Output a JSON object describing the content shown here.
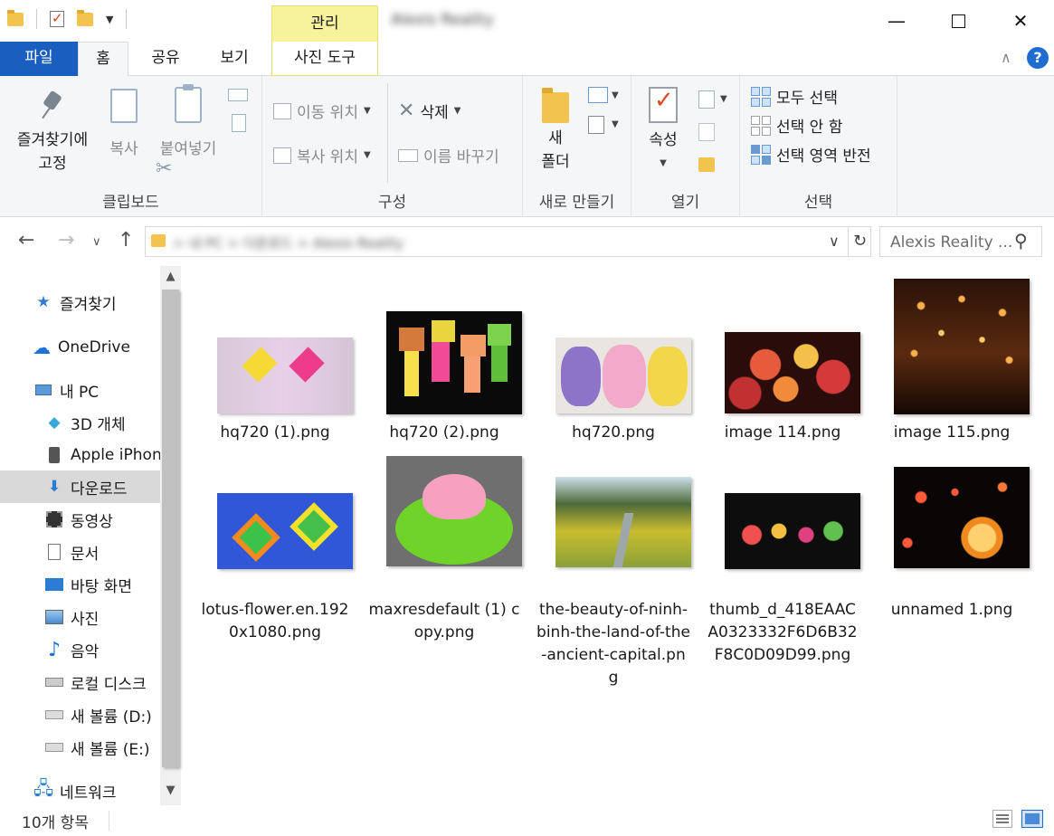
{
  "titlebar": {
    "context_group": "관리",
    "window_title": "Alexis Reality",
    "controls": {
      "minimize": "—",
      "close": "✕"
    }
  },
  "tabs": {
    "file": "파일",
    "home": "홈",
    "share": "공유",
    "view": "보기",
    "photo_tools": "사진 도구"
  },
  "ribbon": {
    "clipboard": {
      "label": "클립보드",
      "pin_line1": "즐겨찾기에",
      "pin_line2": "고정",
      "copy": "복사",
      "paste": "붙여넣기"
    },
    "organize": {
      "label": "구성",
      "move_to": "이동 위치",
      "copy_to": "복사 위치",
      "delete": "삭제",
      "rename": "이름 바꾸기"
    },
    "new": {
      "label": "새로 만들기",
      "new_folder_line1": "새",
      "new_folder_line2": "폴더"
    },
    "open": {
      "label": "열기",
      "properties": "속성"
    },
    "select": {
      "label": "선택",
      "select_all": "모두 선택",
      "select_none": "선택 안 함",
      "invert": "선택 영역 반전"
    }
  },
  "address": {
    "path": "> 내 PC > 다운로드 > Alexis Reality",
    "search_placeholder": "Alexis Reality ..."
  },
  "sidebar": {
    "items": [
      {
        "label": "즐겨찾기",
        "icon": "star-icon"
      },
      {
        "label": "OneDrive",
        "icon": "cloud-icon"
      },
      {
        "label": "내 PC",
        "icon": "computer-icon"
      },
      {
        "label": "3D 개체",
        "icon": "cube-icon"
      },
      {
        "label": "Apple iPhone",
        "icon": "phone-icon"
      },
      {
        "label": "다운로드",
        "icon": "download-icon"
      },
      {
        "label": "동영상",
        "icon": "video-icon"
      },
      {
        "label": "문서",
        "icon": "document-icon"
      },
      {
        "label": "바탕 화면",
        "icon": "desktop-icon"
      },
      {
        "label": "사진",
        "icon": "pictures-icon"
      },
      {
        "label": "음악",
        "icon": "music-icon"
      },
      {
        "label": "로컬 디스크",
        "icon": "drive-icon"
      },
      {
        "label": "새 볼륨 (D:)",
        "icon": "drive-icon"
      },
      {
        "label": "새 볼륨 (E:)",
        "icon": "drive-icon"
      },
      {
        "label": "네트워크",
        "icon": "network-icon"
      }
    ]
  },
  "files": [
    {
      "name": "hq720 (1).png"
    },
    {
      "name": "hq720 (2).png"
    },
    {
      "name": "hq720.png"
    },
    {
      "name": "image 114.png"
    },
    {
      "name": "image 115.png"
    },
    {
      "name": "lotus-flower.en.1920x1080.png"
    },
    {
      "name": "maxresdefault (1) copy.png"
    },
    {
      "name": "the-beauty-of-ninh-binh-the-land-of-the-ancient-capital.png"
    },
    {
      "name": "thumb_d_418EAACA0323332F6D6B32F8C0D09D99.png"
    },
    {
      "name": "unnamed 1.png"
    }
  ],
  "status": {
    "item_count": "10개 항목"
  },
  "colors": {
    "accent": "#1a5ebf",
    "context_tab": "#f7f39c",
    "selected_nav": "#d9d9d9"
  }
}
